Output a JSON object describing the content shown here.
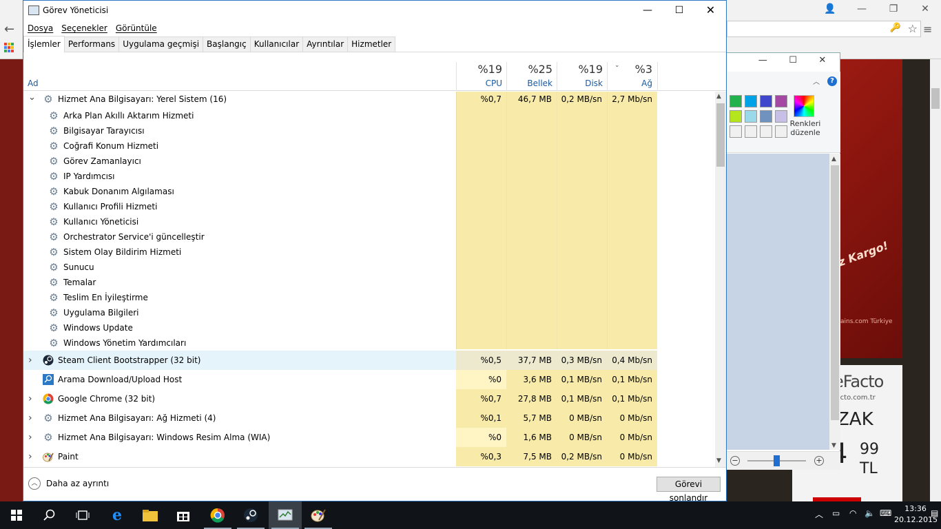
{
  "window": {
    "title": "Görev Yöneticisi",
    "minimize": "—",
    "maximize": "☐",
    "close": "✕"
  },
  "menu": [
    "Dosya",
    "Seçenekler",
    "Görüntüle"
  ],
  "tabs": [
    "İşlemler",
    "Performans",
    "Uygulama geçmişi",
    "Başlangıç",
    "Kullanıcılar",
    "Ayrıntılar",
    "Hizmetler"
  ],
  "active_tab": "İşlemler",
  "columns": {
    "name": "Ad",
    "cpu": {
      "label": "CPU",
      "percent": "%19"
    },
    "memory": {
      "label": "Bellek",
      "percent": "%25"
    },
    "disk": {
      "label": "Disk",
      "percent": "%19"
    },
    "network": {
      "label": "Ağ",
      "percent": "%3"
    }
  },
  "group": {
    "name": "Hizmet Ana Bilgisayarı: Yerel Sistem (16)",
    "cpu": "%0,7",
    "memory": "46,7 MB",
    "disk": "0,2 MB/sn",
    "network": "2,7 Mb/sn",
    "services": [
      "Arka Plan Akıllı Aktarım Hizmeti",
      "Bilgisayar Tarayıcısı",
      "Coğrafi Konum Hizmeti",
      "Görev Zamanlayıcı",
      "IP Yardımcısı",
      "Kabuk Donanım Algılaması",
      "Kullanıcı Profili Hizmeti",
      "Kullanıcı Yöneticisi",
      "Orchestrator Service'i güncelleştir",
      "Sistem Olay Bildirim Hizmeti",
      "Sunucu",
      "Temalar",
      "Teslim En İyileştirme",
      "Uygulama Bilgileri",
      "Windows Update",
      "Windows Yönetim Yardımcıları"
    ]
  },
  "processes": [
    {
      "name": "Steam Client Bootstrapper (32 bit)",
      "icon": "steam-icon",
      "expandable": true,
      "cpu": "%0,5",
      "memory": "37,7 MB",
      "disk": "0,3 MB/sn",
      "network": "0,4 Mb/sn"
    },
    {
      "name": "Arama Download/Upload Host",
      "icon": "search-host-icon",
      "expandable": false,
      "cpu": "%0",
      "memory": "3,6 MB",
      "disk": "0,1 MB/sn",
      "network": "0,1 Mb/sn"
    },
    {
      "name": "Google Chrome (32 bit)",
      "icon": "chrome-icon",
      "expandable": true,
      "cpu": "%0,7",
      "memory": "27,8 MB",
      "disk": "0,1 MB/sn",
      "network": "0,1 Mb/sn"
    },
    {
      "name": "Hizmet Ana Bilgisayarı: Ağ Hizmeti (4)",
      "icon": "gear-icon",
      "expandable": true,
      "cpu": "%0,1",
      "memory": "5,7 MB",
      "disk": "0 MB/sn",
      "network": "0 Mb/sn"
    },
    {
      "name": "Hizmet Ana Bilgisayarı: Windows Resim Alma (WIA)",
      "icon": "gear-icon",
      "expandable": true,
      "cpu": "%0",
      "memory": "1,6 MB",
      "disk": "0 MB/sn",
      "network": "0 Mb/sn"
    },
    {
      "name": "Paint",
      "icon": "paint-icon",
      "expandable": true,
      "cpu": "%0,3",
      "memory": "7,5 MB",
      "disk": "0,2 MB/sn",
      "network": "0 Mb/sn"
    }
  ],
  "footer": {
    "less_details": "Daha az ayrıntı",
    "end_task": "Görevi sonlandır"
  },
  "paint": {
    "edit_colors": "Renkleri düzenle",
    "help": "?",
    "swatches": [
      "#22b14c",
      "#00a2e8",
      "#3f48cc",
      "#a349a4",
      "#b5e61d",
      "#99d9ea",
      "#7092be",
      "#c8bfe7",
      "#f0f0f0",
      "#f0f0f0",
      "#f0f0f0",
      "#f0f0f0"
    ]
  },
  "ad": {
    "slogan": "iz Kargo!",
    "footer_text": "ains.com Türkiye",
    "brand": "eFacto",
    "site": "facto.com.tr",
    "sale": "ZAK",
    "price": "4",
    "price_cents": "99",
    "currency": "TL"
  },
  "taskbar": {
    "time": "13:36",
    "date": "20.12.2015"
  },
  "colors": {
    "heat_high": "#f8eaa8",
    "heat_low": "#fff4c4",
    "selected_row": "#e5f3fb",
    "accent": "#2b78c5"
  }
}
